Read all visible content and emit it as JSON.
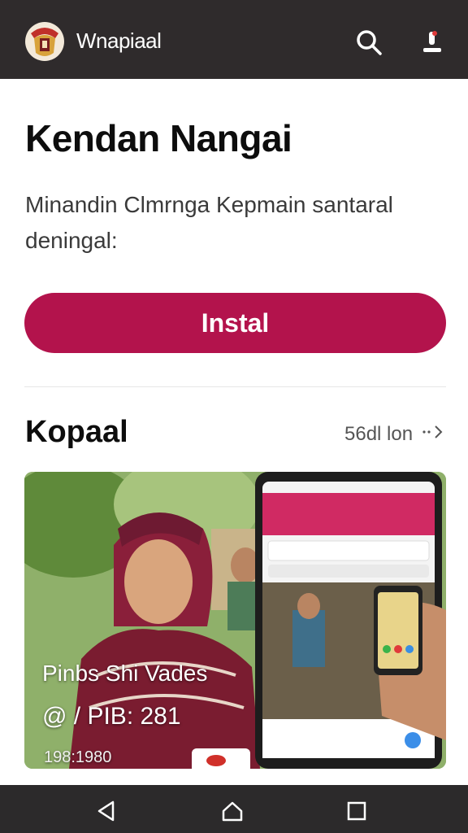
{
  "header": {
    "app_name": "Wnapiaal",
    "logo_icon": "emblem-logo",
    "search_icon": "search-icon",
    "user_icon": "user-icon"
  },
  "main": {
    "title": "Kendan Nangai",
    "description": "Minandin Clmrnga Kepmain santaral deningal:",
    "install_label": "Instal"
  },
  "section": {
    "title": "Kopaal",
    "see_all_label": "56dl lon"
  },
  "media": {
    "caption_line1": "Pinbs Shi Vades",
    "caption_line2": "@ / PIB: 281",
    "caption_line3": "198:1980"
  },
  "navbar": {
    "back_icon": "back-icon",
    "home_icon": "home-icon",
    "recent_icon": "recent-apps-icon"
  },
  "colors": {
    "accent": "#b3134c",
    "topbar": "#2f2b2c",
    "navbar": "#2c2a2b"
  }
}
